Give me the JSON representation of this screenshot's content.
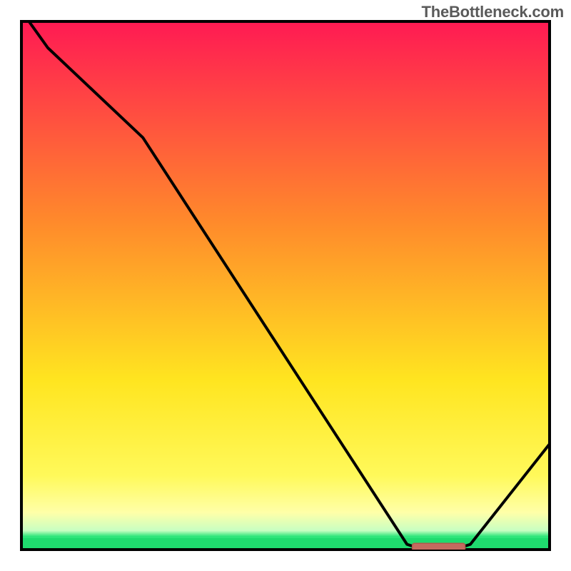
{
  "watermark": "TheBottleneck.com",
  "colors": {
    "gradient_top": "#ff1a53",
    "gradient_mid_orange": "#ff8a2b",
    "gradient_yellow": "#ffe520",
    "gradient_pale_yellow": "#ffffa8",
    "gradient_green_band": "#2ee57a",
    "border": "#000000",
    "curve": "#000000",
    "marker_fill": "#c46a5f",
    "marker_stroke": "#b4574c"
  },
  "chart_data": {
    "type": "line",
    "title": "",
    "xlabel": "",
    "ylabel": "",
    "xlim": [
      0,
      100
    ],
    "ylim": [
      0,
      100
    ],
    "x": [
      0,
      5,
      23,
      73,
      76,
      82,
      85,
      100
    ],
    "values": [
      102,
      95,
      78,
      1,
      0,
      0,
      1,
      20
    ],
    "optimum_band": {
      "x_start": 74,
      "x_end": 84,
      "y": 0.5
    },
    "notes": "Single black curve over a vertical hot-to-cold gradient. Values are percentage-scale estimates from gridless plot; curve starts just above frame at x=0, descends to a flat minimum marked by a short horizontal bar near x≈74–84, then climbs again."
  }
}
